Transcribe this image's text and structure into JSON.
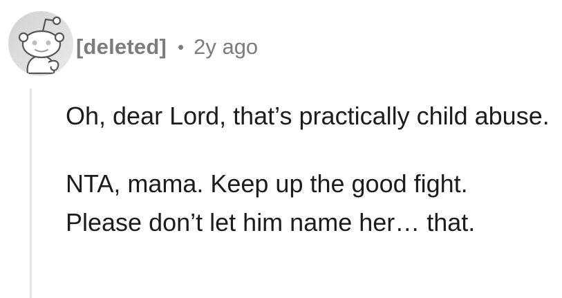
{
  "comment": {
    "author": "[deleted]",
    "separator": "•",
    "timestamp": "2y ago",
    "avatar_icon": "snoo-avatar-icon",
    "paragraphs": [
      "Oh, dear Lord, that’s practically child abuse.",
      "NTA, mama. Keep up the good fight. Please don’t let him name her… that."
    ]
  },
  "colors": {
    "text": "#1c1c1c",
    "meta": "#7c7c7c",
    "thread_line": "#e6e6e6",
    "avatar_bg": "#dcdcdc"
  }
}
